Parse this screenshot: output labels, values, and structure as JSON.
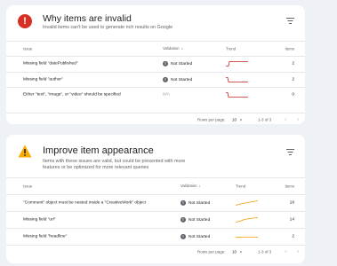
{
  "colors": {
    "error": "#d93025",
    "warning": "#f9ab00",
    "trend_red": "#c5221f",
    "trend_orange": "#f29900"
  },
  "invalid": {
    "title": "Why items are invalid",
    "subtitle": "Invalid items can't be used to generate rich results on Google",
    "status_icon": "!",
    "headers": {
      "issue": "Issue",
      "validation": "Validation",
      "trend": "Trend",
      "items": "Items"
    },
    "rows": [
      {
        "issue": "Missing field \"datePublished\"",
        "validation": "Not Started",
        "items": "2"
      },
      {
        "issue": "Missing field \"author\"",
        "validation": "Not Started",
        "items": "2"
      },
      {
        "issue": "Either \"text\", \"image\", or \"video\" should be specified",
        "validation": "N/A",
        "items": "0"
      }
    ],
    "pager": {
      "label": "Rows per page:",
      "size": "10",
      "range": "1-3 of 3"
    }
  },
  "improve": {
    "title": "Improve item appearance",
    "subtitle": "Items with these issues are valid, but could be presented with more features or be optimized for more relevant queries",
    "headers": {
      "issue": "Issue",
      "validation": "Validation",
      "trend": "Trend",
      "items": "Items"
    },
    "rows": [
      {
        "issue": "\"Comment\" object must be nested inside a \"CreativeWork\" object",
        "validation": "Not Started",
        "items": "18"
      },
      {
        "issue": "Missing field \"url\"",
        "validation": "Not Started",
        "items": "14"
      },
      {
        "issue": "Missing field \"headline\"",
        "validation": "Not Started",
        "items": "2"
      }
    ],
    "pager": {
      "label": "Rows per page:",
      "size": "10",
      "range": "1-3 of 3"
    }
  }
}
